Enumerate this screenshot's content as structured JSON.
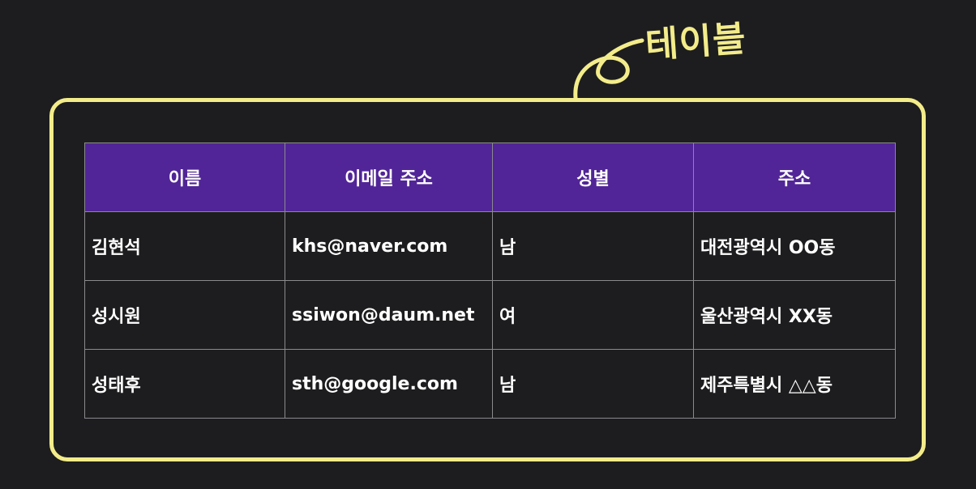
{
  "annotation": {
    "label": "테이블"
  },
  "table": {
    "headers": [
      "이름",
      "이메일 주소",
      "성별",
      "주소"
    ],
    "rows": [
      [
        "김현석",
        "khs@naver.com",
        "남",
        "대전광역시 OO동"
      ],
      [
        "성시원",
        "ssiwon@daum.net",
        "여",
        "울산광역시 XX동"
      ],
      [
        "성태후",
        "sth@google.com",
        "남",
        "제주특별시 △△동"
      ]
    ]
  },
  "colors": {
    "background": "#1d1d1f",
    "frame": "#f3ec8a",
    "header_fill": "#512597",
    "grid": "#8a8a8e",
    "text": "#ffffff"
  }
}
